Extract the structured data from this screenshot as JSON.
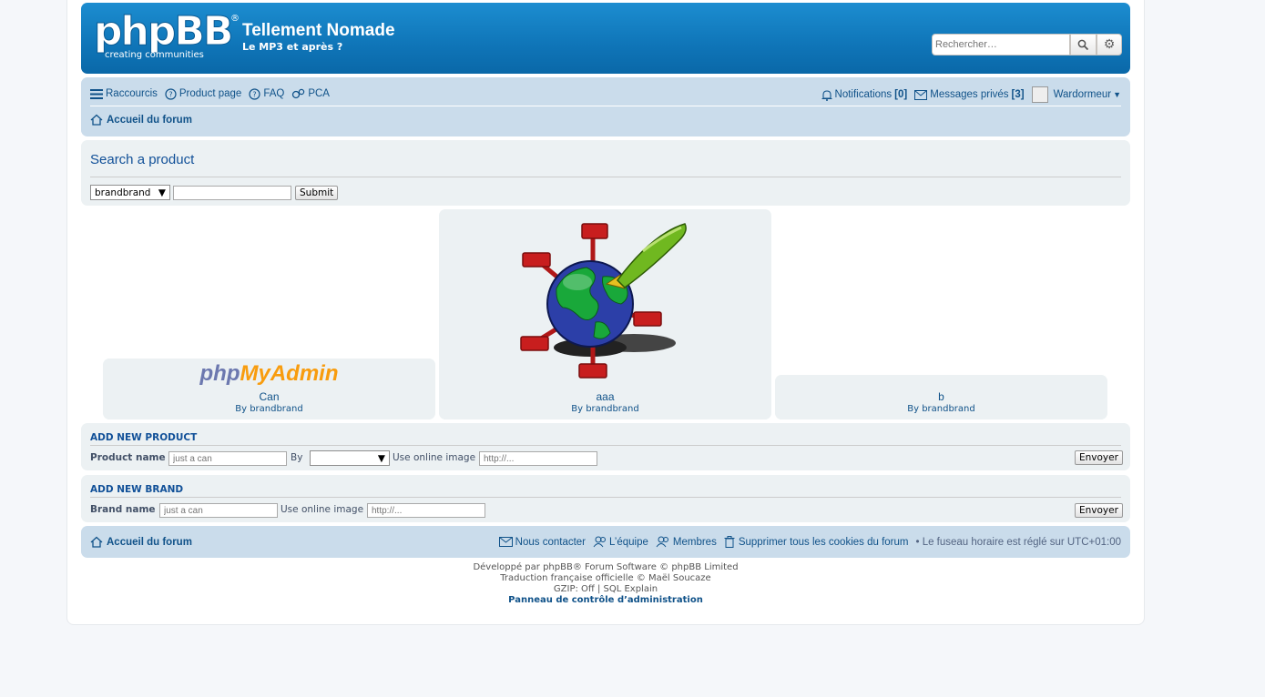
{
  "header": {
    "logo_text": "phpBB",
    "logo_reg": "®",
    "logo_tagline": "creating  communities",
    "site_title": "Tellement Nomade",
    "site_description": "Le MP3 et après ?",
    "search_placeholder": "Rechercher…"
  },
  "navbar": {
    "left_items": [
      {
        "label": "Raccourcis",
        "icon": "menu-icon"
      },
      {
        "label": "Product page",
        "icon": "question-icon"
      },
      {
        "label": "FAQ",
        "icon": "question-icon"
      },
      {
        "label": "PCA",
        "icon": "gears-icon"
      }
    ],
    "notifications_label": "Notifications",
    "notifications_count": "[0]",
    "messages_label": "Messages privés",
    "messages_count": "[3]",
    "username": "Wardormeur",
    "breadcrumb": "Accueil du forum"
  },
  "search_panel": {
    "title": "Search a product",
    "brand_select_value": "brandbrand",
    "query_value": "",
    "submit_label": "Submit"
  },
  "products": [
    {
      "name": "Can",
      "by": "By brandbrand",
      "image": "phpMyAdmin logo",
      "image_text_1": "php",
      "image_text_2": "MyAdmin"
    },
    {
      "name": "aaa",
      "by": "By brandbrand",
      "image": "globe-with-pen illustration"
    },
    {
      "name": "b",
      "by": "By brandbrand",
      "image": ""
    }
  ],
  "add_product": {
    "title": "ADD NEW PRODUCT",
    "name_label": "Product name",
    "name_placeholder": "just a can",
    "by_label": "By",
    "by_value": "",
    "image_label": "Use online image",
    "image_placeholder": "http://...",
    "submit_label": "Envoyer"
  },
  "add_brand": {
    "title": "ADD NEW BRAND",
    "name_label": "Brand name",
    "name_placeholder": "just a can",
    "image_label": "Use online image",
    "image_placeholder": "http://...",
    "submit_label": "Envoyer"
  },
  "footer": {
    "home": "Accueil du forum",
    "contact": "Nous contacter",
    "team": "L’équipe",
    "members": "Membres",
    "delete_cookies": "Supprimer tous les cookies du forum",
    "timezone": "• Le fuseau horaire est réglé sur UTC+01:00",
    "powered": "Développé par phpBB® Forum Software © phpBB Limited",
    "translation": "Traduction française officielle © Maël Soucaze",
    "debug": "GZIP: Off | SQL Explain",
    "acp": "Panneau de contrôle d’administration"
  },
  "colors": {
    "header_blue": "#0f75b8",
    "navbar_bg": "#cadceb",
    "panel_bg": "#ecf1f3",
    "link": "#105289"
  }
}
